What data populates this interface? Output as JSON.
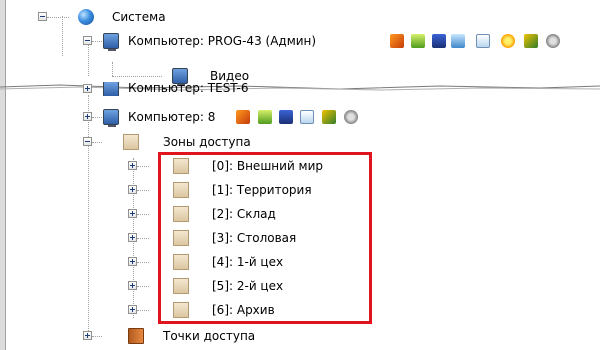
{
  "tree": {
    "root": {
      "label": "Система",
      "expanded": true,
      "icon": "globe-icon"
    },
    "computer_main": {
      "label": "Компьютер: PROG-43 (Админ)",
      "expanded": true,
      "icon": "computer-icon"
    },
    "video": {
      "label": "Видео",
      "icon": "monitor-icon"
    },
    "computer_second": {
      "label": "Компьютер: TEST-6",
      "expanded": false,
      "icon": "computer-icon"
    },
    "computer_third": {
      "label": "Компьютер: 8",
      "expanded": false,
      "icon": "computer-icon"
    },
    "zones": {
      "label": "Зоны доступа",
      "expanded": true,
      "icon": "zone-icon",
      "items": [
        {
          "label": "[0]: Внешний мир"
        },
        {
          "label": "[1]: Территория"
        },
        {
          "label": "[2]: Склад"
        },
        {
          "label": "[3]: Столовая"
        },
        {
          "label": "[4]: 1-й цех"
        },
        {
          "label": "[5]: 2-й цех"
        },
        {
          "label": "[6]: Архив"
        }
      ]
    },
    "access_points": {
      "label": "Точки доступа",
      "expanded": false,
      "icon": "door-icon"
    }
  },
  "status_icons": [
    "wand-icon",
    "folder-icon",
    "monitor-icon",
    "document-icon",
    "document-icon",
    "sun-icon",
    "cards-icon",
    "camera-icon"
  ],
  "colors": {
    "highlight": "#e0141e",
    "tree_line": "#a0a0a0"
  }
}
